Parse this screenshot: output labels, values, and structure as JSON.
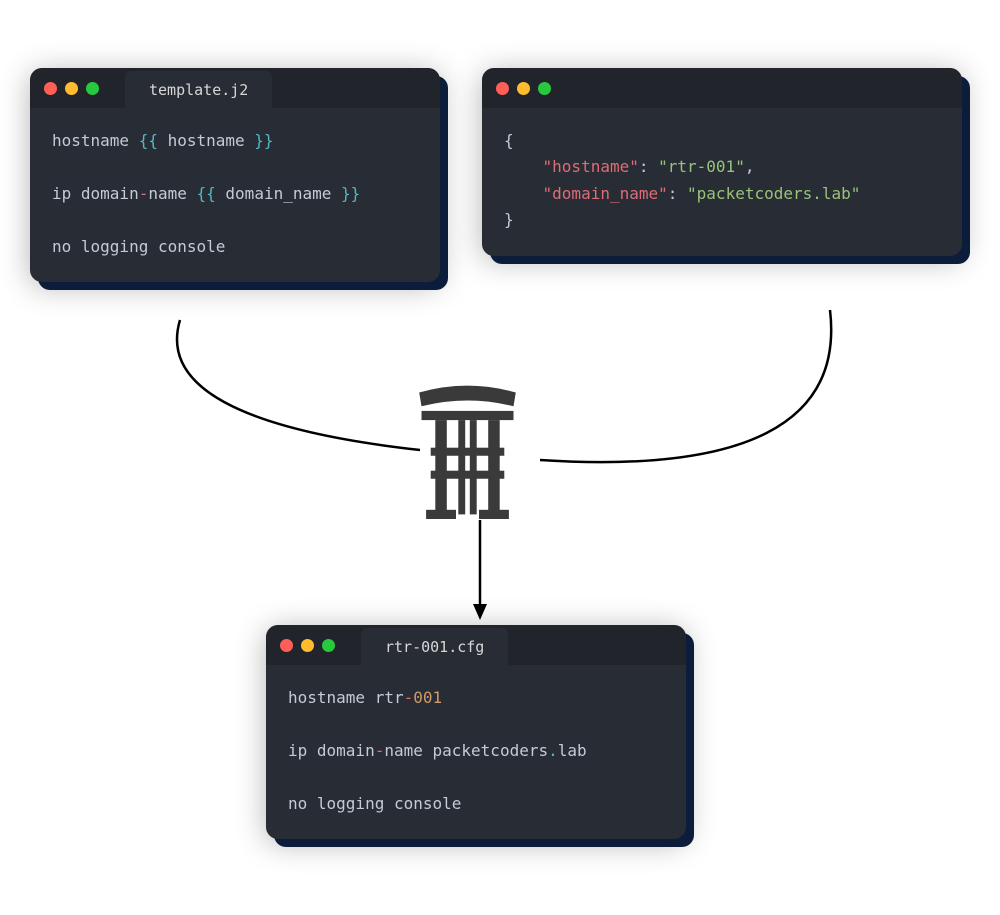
{
  "template": {
    "tab": "template.j2",
    "l1a": "hostname ",
    "l1b": "{{",
    "l1c": " hostname ",
    "l1d": "}}",
    "l2a": "ip domain",
    "l2b": "-",
    "l2c": "name ",
    "l2d": "{{",
    "l2e": " domain_name ",
    "l2f": "}}",
    "l3": "no logging console"
  },
  "json": {
    "l1": "{",
    "l2a": "    ",
    "l2k": "\"hostname\"",
    "l2c": ": ",
    "l2v": "\"rtr-001\"",
    "l2e": ",",
    "l3a": "    ",
    "l3k": "\"domain_name\"",
    "l3c": ": ",
    "l3v": "\"packetcoders.lab\"",
    "l4": "}"
  },
  "output": {
    "tab": "rtr-001.cfg",
    "l1a": "hostname rtr",
    "l1b": "-",
    "l1c": "001",
    "l2a": "ip domain",
    "l2b": "-",
    "l2c": "name packetcoders",
    "l2d": ".",
    "l2e": "lab",
    "l3": "no logging console"
  }
}
